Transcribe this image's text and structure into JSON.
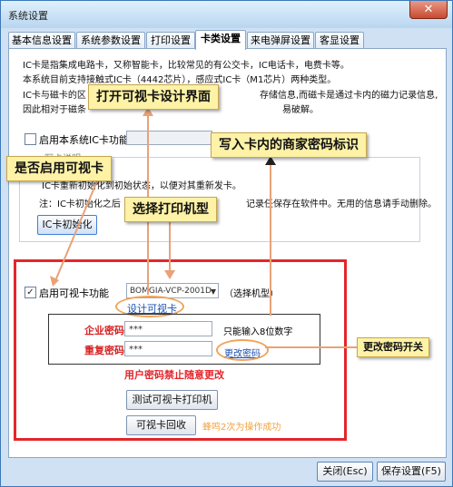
{
  "window": {
    "title": "系统设置",
    "close_glyph": "✕"
  },
  "tabs": [
    {
      "label": "基本信息设置",
      "active": false
    },
    {
      "label": "系统参数设置",
      "active": false
    },
    {
      "label": "打印设置",
      "active": false
    },
    {
      "label": "卡类设置",
      "active": true
    },
    {
      "label": "来电弹屏设置",
      "active": false
    },
    {
      "label": "客显设置",
      "active": false
    }
  ],
  "info": {
    "line1": "IC卡是指集成电路卡，又称智能卡，比较常见的有公交卡，IC电话卡，电费卡等。",
    "line2": "本系统目前支持接触式IC卡（4442芯片），感应式IC卡（M1芯片）两种类型。",
    "line3a": "IC卡与磁卡的区",
    "line3b": "存储信息,而磁卡是通过卡内的磁力记录信息,",
    "line4a": "因此相对于磁条",
    "line4b": "易破解。"
  },
  "ic_enable": {
    "label": "启用本系统IC卡功能",
    "checked": false
  },
  "hidden_group_label": "一、写卡说明",
  "ic_note": {
    "line1": "IC卡重新初始化到初始状态，以便对其重新发卡。",
    "line2a": "注：IC卡初始化之后",
    "line2b": "记录任保存在软件中。无用的信息请手动删除。"
  },
  "ic_init_button": "IC卡初始化",
  "visual_card": {
    "enable_label": "启用可视卡功能",
    "checked": true,
    "printer_model": "BOMGIA-VCP-2001D",
    "select_model_note": "（选择机型）",
    "design_link": "设计可视卡"
  },
  "password": {
    "merchant_label": "企业密码：",
    "merchant_value": "***",
    "hint": "只能输入8位数字",
    "repeat_label": "重复密码：",
    "repeat_value": "***",
    "change_link": "更改密码",
    "warning": "用户密码禁止随意更改"
  },
  "test_print_button": "测试可视卡打印机",
  "recycle_button": "可视卡回收",
  "recycle_hint": "蜂鸣2次为操作成功",
  "footer": {
    "close_button": "关闭(Esc)",
    "save_button": "保存设置(F5)"
  },
  "callouts": {
    "open_designer": "打开可视卡设计界面",
    "write_key": "写入卡内的商家密码标识",
    "enable_visual": "是否启用可视卡",
    "select_printer": "选择打印机型",
    "password_switch": "更改密码开关"
  },
  "colors": {
    "annotation_red": "#e3262b",
    "callout_bg": "#fdf2a6",
    "arrow": "#e9a277",
    "link": "#1a4fb0"
  }
}
